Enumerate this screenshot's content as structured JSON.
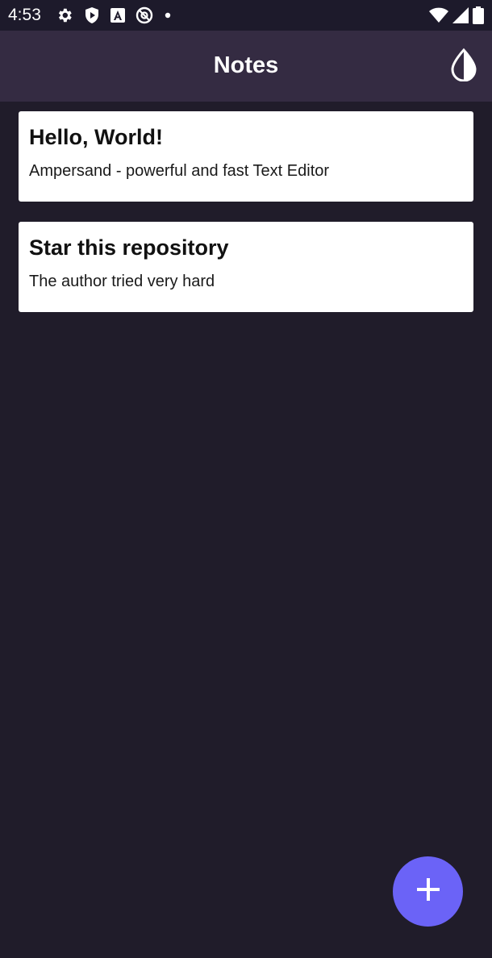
{
  "status_bar": {
    "time": "4:53",
    "left_icons": [
      "settings-icon",
      "shield-icon",
      "text-a-icon",
      "at-sign-icon",
      "dot-icon"
    ],
    "right_icons": [
      "wifi-icon",
      "signal-icon",
      "battery-icon"
    ]
  },
  "app_bar": {
    "title": "Notes",
    "theme_icon": "contrast-drop-icon"
  },
  "notes": [
    {
      "title": "Hello, World!",
      "body": "Ampersand - powerful and fast Text Editor"
    },
    {
      "title": "Star this repository",
      "body": "The author tried very hard"
    }
  ],
  "fab": {
    "icon": "plus-icon"
  },
  "colors": {
    "background": "#201c2a",
    "app_bar": "#342b42",
    "status_bar": "#1d1a2b",
    "card": "#ffffff",
    "fab": "#6b63f7"
  }
}
